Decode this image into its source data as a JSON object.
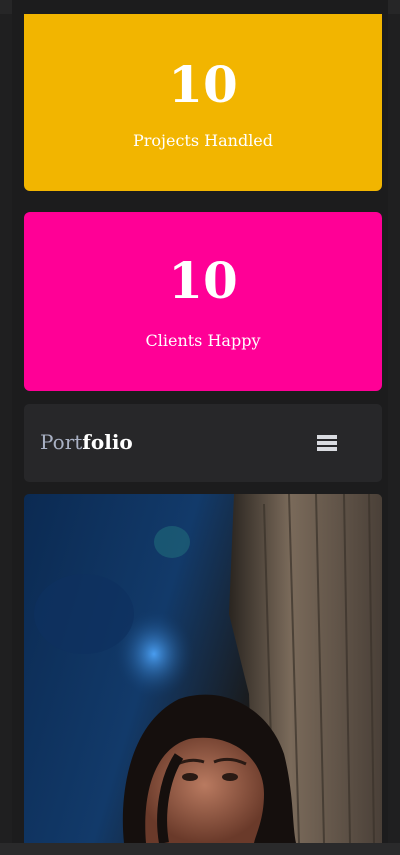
{
  "stats": [
    {
      "number": "10",
      "label": "Projects Handled",
      "color": "#f2b500"
    },
    {
      "number": "10",
      "label": "Clients Happy",
      "color": "#ff0096"
    }
  ],
  "header": {
    "logo_part1": "Port",
    "logo_part2": "folio",
    "menu_icon": "hamburger-menu-icon"
  },
  "colors": {
    "background": "#1c1c1d",
    "header_bg": "#272729",
    "logo_muted": "#a9b1c4"
  }
}
